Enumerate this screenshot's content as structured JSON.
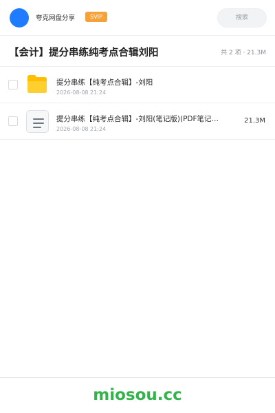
{
  "header": {
    "app_name": "夸克网盘分享",
    "badge": "SVIP",
    "search_placeholder": "搜索",
    "avatar_color": "#1f7cff",
    "badge_color": "#f6a23a"
  },
  "share": {
    "title": "【会计】提分串练纯考点合辑刘阳",
    "summary": "共 2 项 · 21.3M"
  },
  "files": [
    {
      "name": "提分串练【纯考点合辑】-刘阳",
      "time": "2026-08-08 21:24",
      "size": "",
      "icon": "folder-icon"
    },
    {
      "name": "提分串练【纯考点合辑】-刘阳(笔记版)(PDF笔记…",
      "time": "2026-08-08 21:24",
      "size": "21.3M",
      "icon": "document-icon"
    }
  ],
  "footer": {
    "brand": "miosou.cc",
    "brand_color": "#33b44a"
  }
}
